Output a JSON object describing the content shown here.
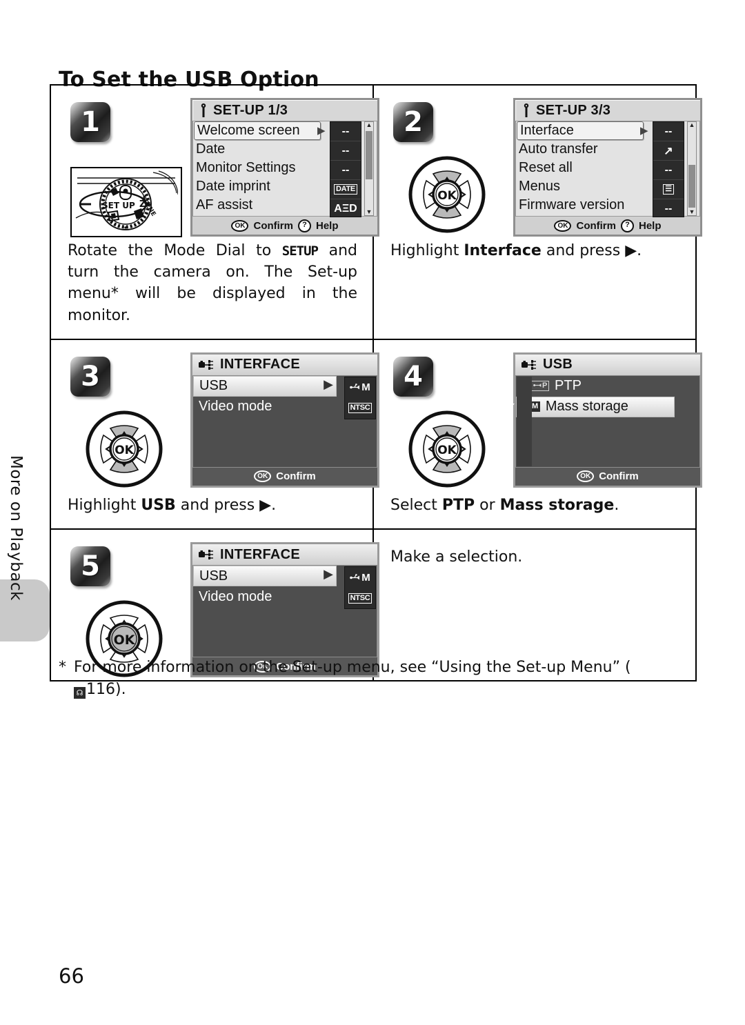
{
  "page": {
    "title": "To Set the USB Option",
    "number": "66",
    "side_tab_label": "More on Playback"
  },
  "footnote": {
    "marker": "*",
    "text": "For more information on the Set-up menu, see “Using the Set-up Menu” (",
    "ref_icon": "book-icon",
    "ref_page": "116",
    "suffix": ")."
  },
  "steps": [
    {
      "number": "1",
      "illustration": "mode-dial",
      "dial_label": "SET UP",
      "dial_scene_label": "SCENE",
      "screen": {
        "style": "light",
        "icon": "wrench-icon",
        "title": "SET-UP 1/3",
        "rows": [
          {
            "label": "Welcome screen",
            "value": "--",
            "selected": true,
            "has_arrow": true
          },
          {
            "label": "Date",
            "value": "--",
            "selected": false,
            "has_arrow": false
          },
          {
            "label": "Monitor Settings",
            "value": "--",
            "selected": false,
            "has_arrow": false
          },
          {
            "label": "Date imprint",
            "value": "DATE",
            "selected": false,
            "has_arrow": false
          },
          {
            "label": "AF assist",
            "value": "AΞD",
            "selected": false,
            "has_arrow": false
          }
        ],
        "footer": [
          {
            "icon": "ok-icon",
            "glyph": "OK",
            "label": "Confirm"
          },
          {
            "icon": "help-icon",
            "glyph": "?",
            "label": "Help"
          }
        ],
        "scrollbar": {
          "visible": true,
          "up": "▲",
          "down": "▼",
          "thumb_top_pct": 2,
          "thumb_height_pct": 52
        }
      },
      "caption_parts": [
        {
          "t": "Rotate the Mode Dial to ",
          "style": "normal"
        },
        {
          "t": "SETUP",
          "style": "mono"
        },
        {
          "t": " and turn the camera on. The Set-up menu* will be displayed in the monitor.",
          "style": "normal"
        }
      ]
    },
    {
      "number": "2",
      "illustration": "multi-selector",
      "multi_selector": {
        "ok_label": "OK",
        "up": "▲",
        "down": "▼",
        "left": "◁",
        "right": "▷",
        "pads_filled": true,
        "ok_filled": false
      },
      "screen": {
        "style": "light",
        "icon": "wrench-icon",
        "title": "SET-UP 3/3",
        "rows": [
          {
            "label": "Interface",
            "value": "--",
            "selected": true,
            "has_arrow": true
          },
          {
            "label": "Auto transfer",
            "value": "↗",
            "selected": false,
            "has_arrow": false
          },
          {
            "label": "Reset all",
            "value": "--",
            "selected": false,
            "has_arrow": false
          },
          {
            "label": "Menus",
            "value": "☰",
            "selected": false,
            "has_arrow": false
          },
          {
            "label": "Firmware version",
            "value": "--",
            "selected": false,
            "has_arrow": false
          }
        ],
        "footer": [
          {
            "icon": "ok-icon",
            "glyph": "OK",
            "label": "Confirm"
          },
          {
            "icon": "help-icon",
            "glyph": "?",
            "label": "Help"
          }
        ],
        "scrollbar": {
          "visible": true,
          "up": "▲",
          "down": "▼",
          "thumb_top_pct": 46,
          "thumb_height_pct": 50
        }
      },
      "caption_parts": [
        {
          "t": "Highlight ",
          "style": "normal"
        },
        {
          "t": "Interface",
          "style": "bold"
        },
        {
          "t": " and press ",
          "style": "normal"
        },
        {
          "t": "▶",
          "style": "normal"
        },
        {
          "t": ".",
          "style": "normal"
        }
      ]
    },
    {
      "number": "3",
      "illustration": "multi-selector",
      "multi_selector": {
        "ok_label": "OK",
        "up": "▲",
        "down": "▼",
        "left": "◁",
        "right": "▷",
        "pads_filled": true,
        "ok_filled": false
      },
      "screen": {
        "style": "dark",
        "icon": "camera-usb-icon",
        "title": "INTERFACE",
        "rows": [
          {
            "label": "USB",
            "value": "M",
            "value_icon": "usb-icon",
            "selected": true,
            "has_arrow": true
          },
          {
            "label": "Video mode",
            "value": "NTSC",
            "selected": false,
            "has_arrow": false
          }
        ],
        "footer": [
          {
            "icon": "ok-icon",
            "glyph": "OK",
            "label": "Confirm"
          }
        ],
        "scrollbar": {
          "visible": false
        }
      },
      "caption_parts": [
        {
          "t": "Highlight ",
          "style": "normal"
        },
        {
          "t": "USB",
          "style": "bold"
        },
        {
          "t": " and press ",
          "style": "normal"
        },
        {
          "t": "▶",
          "style": "normal"
        },
        {
          "t": ".",
          "style": "normal"
        }
      ]
    },
    {
      "number": "4",
      "illustration": "multi-selector",
      "multi_selector": {
        "ok_label": "OK",
        "up": "▲",
        "down": "▼",
        "left": "◁",
        "right": "▷",
        "pads_filled": true,
        "ok_filled": false
      },
      "screen": {
        "style": "dark",
        "variant": "options",
        "icon": "camera-usb-icon",
        "title": "USB",
        "options": [
          {
            "label": "PTP",
            "chip": "P",
            "chip_icon": "usb-icon",
            "selected": false,
            "checked": false
          },
          {
            "label": "Mass storage",
            "chip": "M",
            "chip_icon": "usb-icon",
            "selected": true,
            "checked": true
          }
        ],
        "footer": [
          {
            "icon": "ok-icon",
            "glyph": "OK",
            "label": "Confirm"
          }
        ]
      },
      "caption_parts": [
        {
          "t": "Select ",
          "style": "normal"
        },
        {
          "t": "PTP",
          "style": "bold"
        },
        {
          "t": " or ",
          "style": "normal"
        },
        {
          "t": "Mass storage",
          "style": "bold"
        },
        {
          "t": ".",
          "style": "normal"
        }
      ]
    },
    {
      "number": "5",
      "illustration": "multi-selector",
      "multi_selector": {
        "ok_label": "OK",
        "up": "△",
        "down": "▽",
        "left": "◁",
        "right": "▷",
        "pads_filled": false,
        "ok_filled": true
      },
      "screen": {
        "style": "dark",
        "icon": "camera-usb-icon",
        "title": "INTERFACE",
        "rows": [
          {
            "label": "USB",
            "value": "M",
            "value_icon": "usb-icon",
            "selected": true,
            "has_arrow": true
          },
          {
            "label": "Video mode",
            "value": "NTSC",
            "selected": false,
            "has_arrow": false
          }
        ],
        "footer": [
          {
            "icon": "ok-icon",
            "glyph": "OK",
            "label": "Confirm"
          }
        ],
        "scrollbar": {
          "visible": false
        }
      },
      "caption_parts": [],
      "side_caption": "Make a selection."
    }
  ]
}
